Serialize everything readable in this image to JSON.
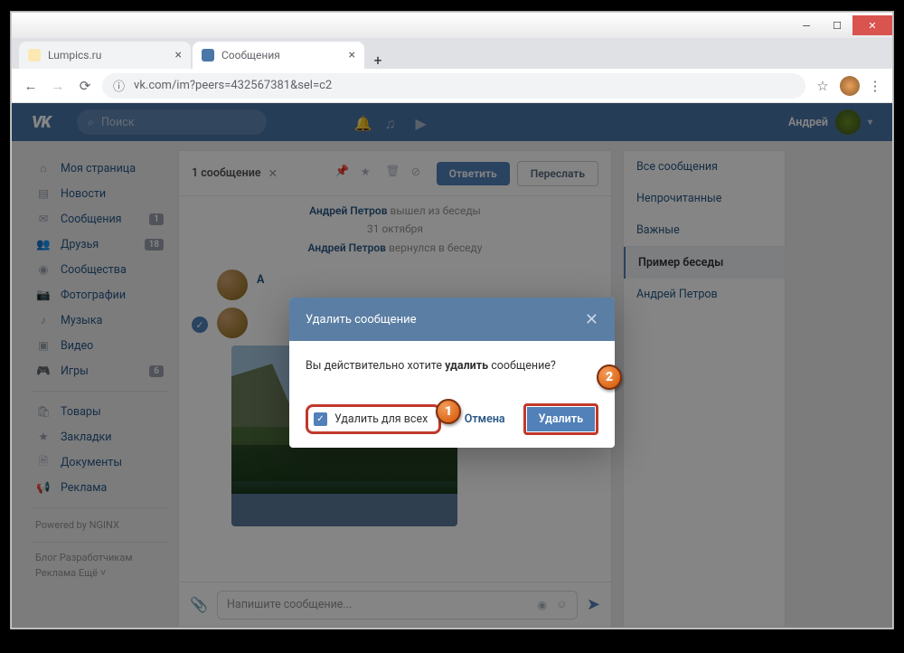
{
  "browser": {
    "tabs": [
      {
        "title": "Lumpics.ru"
      },
      {
        "title": "Сообщения"
      }
    ],
    "url": "vk.com/im?peers=432567381&sel=c2"
  },
  "vk": {
    "search_placeholder": "Поиск",
    "username": "Андрей"
  },
  "sidebar": {
    "items": [
      {
        "label": "Моя страница"
      },
      {
        "label": "Новости"
      },
      {
        "label": "Сообщения",
        "badge": "1"
      },
      {
        "label": "Друзья",
        "badge": "18"
      },
      {
        "label": "Сообщества"
      },
      {
        "label": "Фотографии"
      },
      {
        "label": "Музыка"
      },
      {
        "label": "Видео"
      },
      {
        "label": "Игры",
        "badge": "6"
      }
    ],
    "items2": [
      {
        "label": "Товары"
      },
      {
        "label": "Закладки"
      },
      {
        "label": "Документы"
      },
      {
        "label": "Реклама"
      }
    ],
    "powered": "Powered by NGINX",
    "links1": "Блог   Разработчикам",
    "links2": "Реклама   Ещё ˅"
  },
  "chat": {
    "selection_text": "1 сообщение",
    "reply": "Ответить",
    "forward": "Переслать",
    "sys1_name": "Андрей Петров",
    "sys1_action": " вышел из беседы",
    "sys_date": "31 октября",
    "sys2_name": "Андрей Петров",
    "sys2_action": " вернулся в беседу",
    "msg_author_initial": "А",
    "composer_placeholder": "Напишите сообщение..."
  },
  "right": {
    "items": [
      "Все сообщения",
      "Непрочитанные",
      "Важные"
    ],
    "conv_active": "Пример беседы",
    "conv2": "Андрей Петров"
  },
  "modal": {
    "title": "Удалить сообщение",
    "body_pre": "Вы действительно хотите ",
    "body_bold": "удалить",
    "body_post": " сообщение?",
    "check_label": "Удалить для всех",
    "cancel": "Отмена",
    "delete": "Удалить"
  },
  "callouts": {
    "one": "1",
    "two": "2"
  }
}
